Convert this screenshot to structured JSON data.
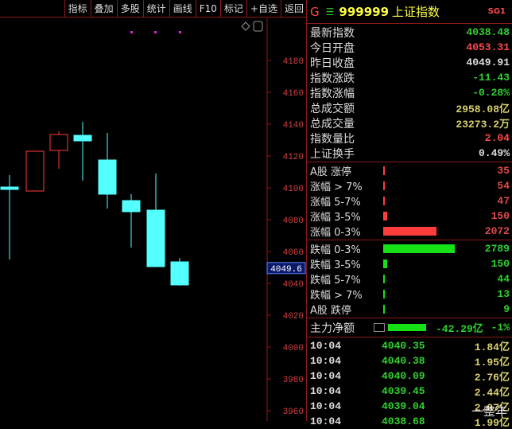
{
  "toolbar": [
    "指标",
    "叠加",
    "多股",
    "统计",
    "画线",
    "F10",
    "标记",
    "+自选",
    "返回"
  ],
  "chart": {
    "y_ticks": [
      4180,
      4160,
      4140,
      4120,
      4100,
      4080,
      4060,
      4040,
      4020,
      4000,
      3980,
      3960
    ],
    "current_price_label": "4049.6",
    "candles": [
      {
        "o": 4100.5,
        "c": 4099,
        "h": 4108,
        "l": 4055
      },
      {
        "o": 4098,
        "c": 4123,
        "h": 4123,
        "l": 4098
      },
      {
        "o": 4123.5,
        "c": 4133.5,
        "h": 4135.5,
        "l": 4112
      },
      {
        "o": 4133,
        "c": 4129.5,
        "h": 4141.5,
        "l": 4104.5
      },
      {
        "o": 4117.5,
        "c": 4096,
        "h": 4134.5,
        "l": 4087
      },
      {
        "o": 4092,
        "c": 4085,
        "h": 4096,
        "l": 4062.5
      },
      {
        "o": 4086,
        "c": 4050.5,
        "h": 4109,
        "l": 4050.5
      },
      {
        "o": 4053.5,
        "c": 4039,
        "h": 4056,
        "l": 4038.5
      }
    ],
    "up_color": "#ff3c3c",
    "down_color": "#54ffff"
  },
  "header": {
    "g": "G",
    "menu": "☰",
    "code": "999999",
    "name": "上证指数",
    "tag": "SG1"
  },
  "quote": [
    {
      "label": "最新指数",
      "value": "4038.48",
      "color": "#2ed12e"
    },
    {
      "label": "今日开盘",
      "value": "4053.31",
      "color": "#ff4a4a"
    },
    {
      "label": "昨日收盘",
      "value": "4049.91",
      "color": "#dddddd"
    },
    {
      "label": "指数涨跌",
      "value": "-11.43",
      "color": "#2ed12e"
    },
    {
      "label": "指数涨幅",
      "value": "-0.28%",
      "color": "#2ed12e"
    },
    {
      "label": "总成交额",
      "value": "2958.08亿",
      "color": "#d8d070"
    },
    {
      "label": "总成交量",
      "value": "23273.2万",
      "color": "#d8d070"
    },
    {
      "label": "指数量比",
      "value": "2.04",
      "color": "#ff4a4a"
    },
    {
      "label": "上证换手",
      "value": "0.49%",
      "color": "#dddddd"
    }
  ],
  "up_dist": [
    {
      "label": "A股 涨停",
      "value": "35",
      "pct": 0.5
    },
    {
      "label": "涨幅 > 7%",
      "value": "54",
      "pct": 0.5
    },
    {
      "label": "涨幅 5-7%",
      "value": "47",
      "pct": 0.5
    },
    {
      "label": "涨幅 3-5%",
      "value": "150",
      "pct": 5.4
    },
    {
      "label": "涨幅 0-3%",
      "value": "2072",
      "pct": 74.3
    }
  ],
  "down_dist": [
    {
      "label": "跌幅 0-3%",
      "value": "2789",
      "pct": 100
    },
    {
      "label": "跌幅 3-5%",
      "value": "150",
      "pct": 5.4
    },
    {
      "label": "跌幅 5-7%",
      "value": "44",
      "pct": 0.5
    },
    {
      "label": "跌幅 > 7%",
      "value": "13",
      "pct": 0.5
    },
    {
      "label": "A股 跌停",
      "value": "9",
      "pct": 0.5
    }
  ],
  "main_flow": {
    "label": "主力净额",
    "amount": "-42.29亿",
    "pct": "-1%"
  },
  "ticks": [
    {
      "time": "10:04",
      "price": "4040.35",
      "amount": "1.84亿"
    },
    {
      "time": "10:04",
      "price": "4040.38",
      "amount": "1.95亿"
    },
    {
      "time": "10:04",
      "price": "4040.09",
      "amount": "2.76亿"
    },
    {
      "time": "10:04",
      "price": "4039.45",
      "amount": "2.44亿"
    },
    {
      "time": "10:04",
      "price": "4039.04",
      "amount": "2.07亿"
    },
    {
      "time": "10:04",
      "price": "4038.68",
      "amount": "1.99亿"
    }
  ],
  "watermark": "一整年"
}
